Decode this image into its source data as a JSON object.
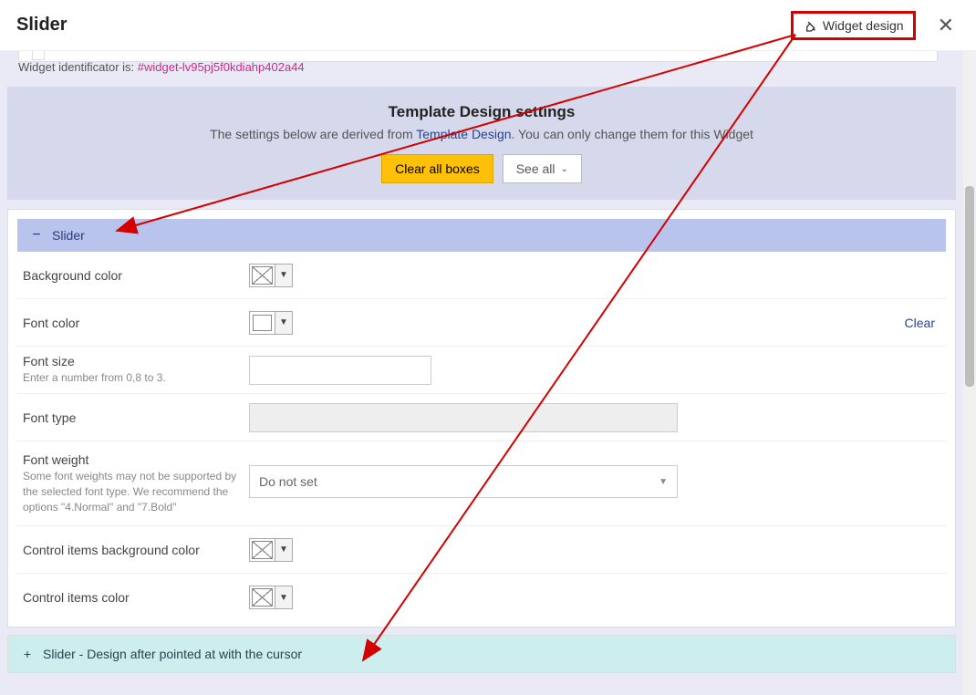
{
  "header": {
    "title": "Slider",
    "widget_design_btn": "Widget design"
  },
  "ident": {
    "prefix": "Widget identificator is: ",
    "id": "#widget-lv95pj5f0kdiahp402a44"
  },
  "hero": {
    "title": "Template Design settings",
    "desc_before": "The settings below are derived from ",
    "desc_link": "Template Design",
    "desc_after": ". You can only change them for this Widget",
    "clear_all": "Clear all boxes",
    "see_all": "See all"
  },
  "accordion_open": {
    "label": "Slider"
  },
  "rows": {
    "bg_color": {
      "label": "Background color"
    },
    "font_color": {
      "label": "Font color",
      "clear": "Clear"
    },
    "font_size": {
      "label": "Font size",
      "sub": "Enter a number from 0,8 to 3."
    },
    "font_type": {
      "label": "Font type"
    },
    "font_weight": {
      "label": "Font weight",
      "sub": "Some font weights may not be supported by the selected font type. We recommend the options \"4.Normal\" and \"7.Bold\"",
      "placeholder": "Do not set"
    },
    "ctrl_bg": {
      "label": "Control items background color"
    },
    "ctrl_color": {
      "label": "Control items color"
    }
  },
  "accordion_closed": {
    "label": "Slider - Design after pointed at with the cursor"
  }
}
